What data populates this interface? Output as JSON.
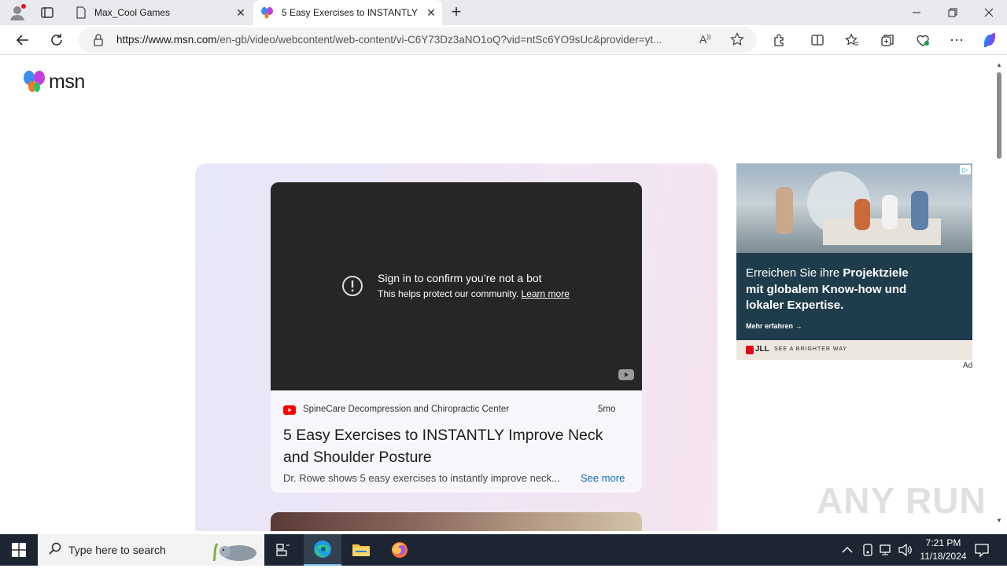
{
  "browser": {
    "tabs": [
      {
        "title": "Max_Cool Games",
        "active": false
      },
      {
        "title": "5 Easy Exercises to INSTANTLY Im",
        "active": true
      }
    ],
    "url_host": "https://www.msn.com",
    "url_path": "/en-gb/video/webcontent/web-content/vi-C6Y73Dz3aNO1oQ?vid=ntSc6YO9sUc&provider=yt..."
  },
  "page": {
    "logo_text": "msn",
    "video": {
      "message_title": "Sign in to confirm you’re not a bot",
      "message_body": "This helps protect our community.",
      "learn_more": "Learn more"
    },
    "card": {
      "source": "SpineCare Decompression and Chiropractic Center",
      "age": "5mo",
      "title": "5 Easy Exercises to INSTANTLY Improve Neck and Shoulder Posture",
      "description": "Dr. Rowe shows 5 easy exercises to instantly improve neck...",
      "see_more": "See more"
    },
    "ad": {
      "headline_prefix": "Erreichen Sie ihre ",
      "headline_bold": "Projektziele mit globalem Know-how und lokaler Expertise.",
      "cta": "Mehr erfahren →",
      "brand": "JLL",
      "tagline": "SEE A BRIGHTER WAY",
      "label": "Ad"
    },
    "watermark": "ANY RUN"
  },
  "taskbar": {
    "search_placeholder": "Type here to search",
    "time": "7:21 PM",
    "date": "11/18/2024"
  },
  "colors": {
    "accent_link": "#0f6cbd",
    "youtube_red": "#ff0000",
    "ad_bg": "#1e3c4b",
    "taskbar_bg": "#1c2531"
  }
}
